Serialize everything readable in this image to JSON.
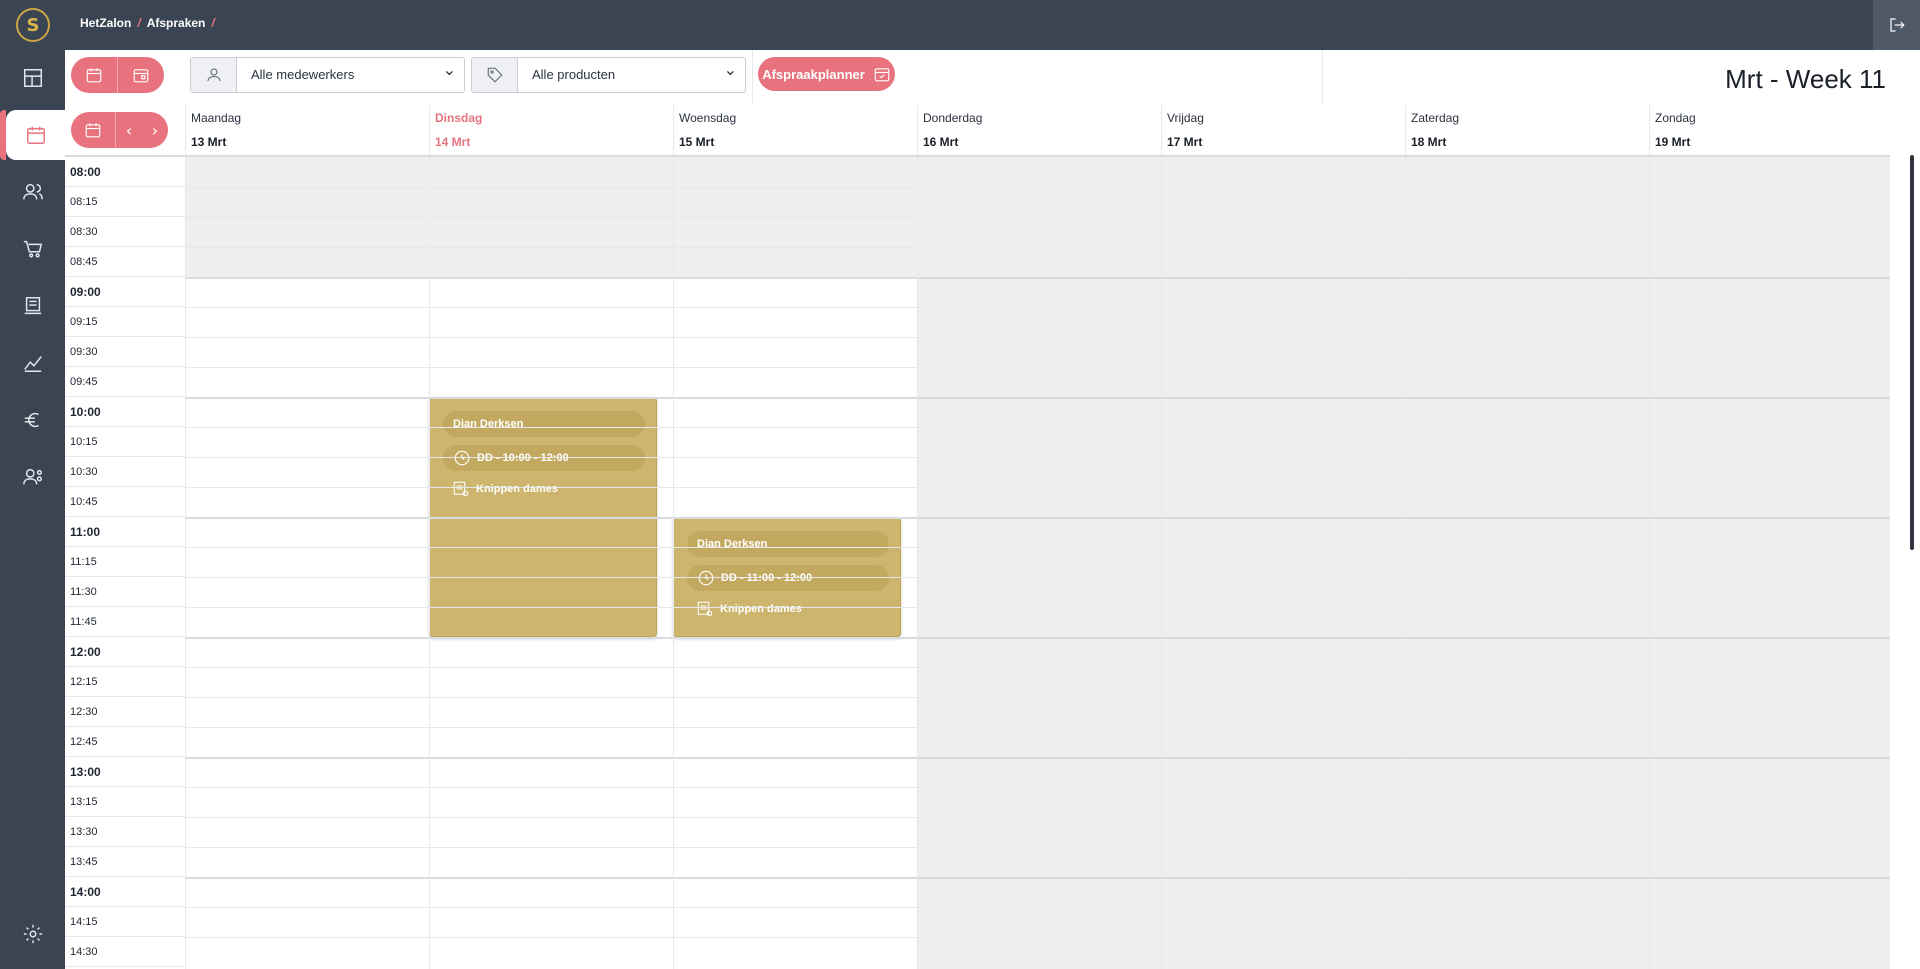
{
  "app": {
    "logo_letter": "S"
  },
  "breadcrumb": {
    "items": [
      "HetZalon",
      "Afspraken"
    ],
    "separator": "/"
  },
  "toolbar": {
    "employee_select": "Alle medewerkers",
    "product_select": "Alle producten",
    "planner_button": "Afspraakplanner",
    "week_title": "Mrt - Week 11"
  },
  "days": [
    {
      "name": "Maandag",
      "date": "13 Mrt"
    },
    {
      "name": "Dinsdag",
      "date": "14 Mrt"
    },
    {
      "name": "Woensdag",
      "date": "15 Mrt"
    },
    {
      "name": "Donderdag",
      "date": "16 Mrt"
    },
    {
      "name": "Vrijdag",
      "date": "17 Mrt"
    },
    {
      "name": "Zaterdag",
      "date": "18 Mrt"
    },
    {
      "name": "Zondag",
      "date": "19 Mrt"
    }
  ],
  "times": [
    "08:00",
    "08:15",
    "08:30",
    "08:45",
    "09:00",
    "09:15",
    "09:30",
    "09:45",
    "10:00",
    "10:15",
    "10:30",
    "10:45",
    "11:00",
    "11:15",
    "11:30",
    "11:45",
    "12:00",
    "12:15",
    "12:30",
    "12:45",
    "13:00",
    "13:15",
    "13:30",
    "13:45",
    "14:00",
    "14:15",
    "14:30"
  ],
  "appointments": [
    {
      "client": "Dian Derksen",
      "time": "DD - 10:00 - 12:00",
      "product": "Knippen dames"
    },
    {
      "client": "Dian Derksen",
      "time": "DD - 11:00 - 12:00",
      "product": "Knippen dames"
    }
  ],
  "colors": {
    "accent": "#e8737f",
    "sidebar": "#3b4452",
    "appointment": "#cdb56e"
  }
}
